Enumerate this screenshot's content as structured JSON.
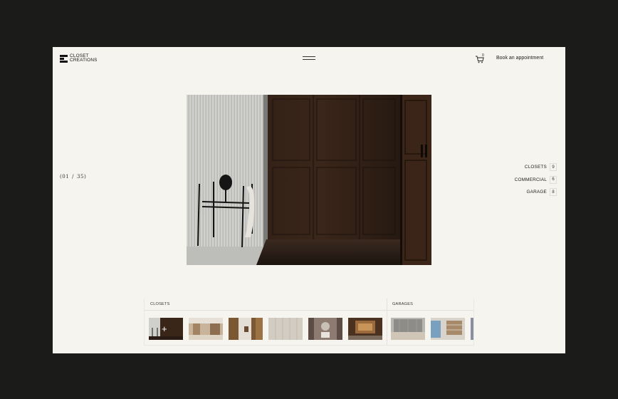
{
  "brand": {
    "line1": "CLOSET",
    "line2": "CREATIONS"
  },
  "header": {
    "cart_count": "0",
    "book_label": "Book an appointment"
  },
  "slider": {
    "current": "01",
    "separator": "/",
    "total": "35"
  },
  "categories": [
    {
      "label": "CLOSETS",
      "count": "9"
    },
    {
      "label": "COMMERCIAL",
      "count": "6"
    },
    {
      "label": "GARAGE",
      "count": "8"
    }
  ],
  "strip": {
    "closets_label": "CLOSETS",
    "garages_label": "GARAGES"
  },
  "icons": {
    "menu": "menu-icon",
    "cart": "cart-icon",
    "plus": "plus-icon"
  },
  "colors": {
    "page_bg": "#f6f4ee",
    "outer_bg": "#1b1b1a",
    "text": "#222222"
  }
}
